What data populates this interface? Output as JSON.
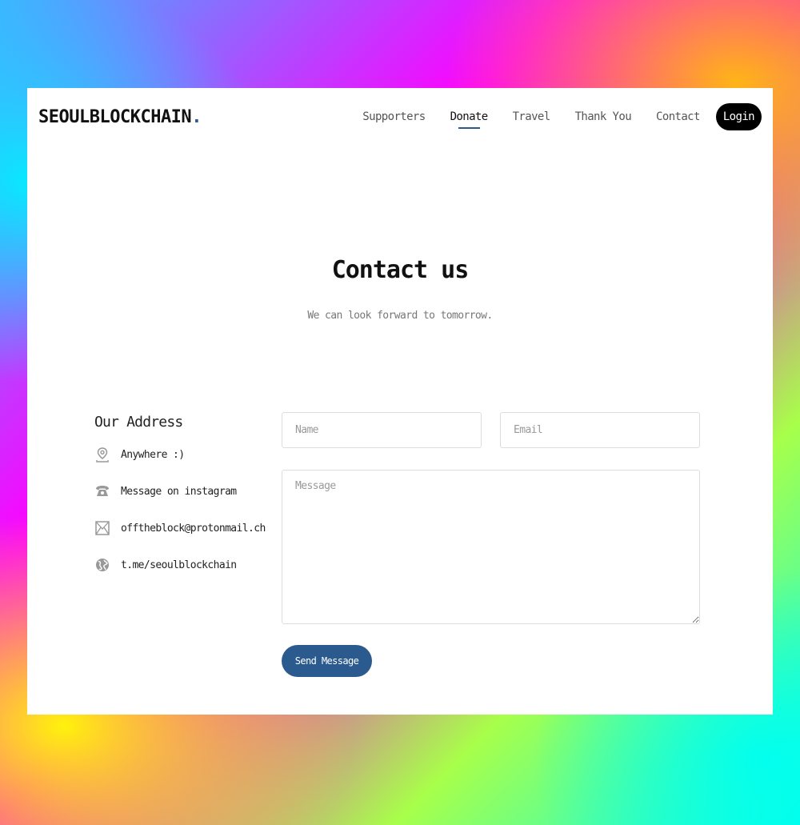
{
  "brand": {
    "name": "SEOULBLOCKCHAIN",
    "dot": "."
  },
  "nav": {
    "items": [
      {
        "label": "Supporters"
      },
      {
        "label": "Donate"
      },
      {
        "label": "Travel"
      },
      {
        "label": "Thank You"
      },
      {
        "label": "Contact"
      }
    ],
    "active": "Donate",
    "login_label": "Login"
  },
  "hero": {
    "title": "Contact us",
    "subtitle": "We can look forward to tomorrow."
  },
  "address": {
    "heading": "Our Address",
    "items": [
      {
        "icon": "map-pin-icon",
        "text": "Anywhere :)"
      },
      {
        "icon": "phone-icon",
        "text": "Message on instagram"
      },
      {
        "icon": "envelope-icon",
        "text": "offtheblock@protonmail.ch"
      },
      {
        "icon": "globe-icon",
        "text": "t.me/seoulblockchain"
      }
    ]
  },
  "form": {
    "name_placeholder": "Name",
    "email_placeholder": "Email",
    "message_placeholder": "Message",
    "send_label": "Send Message"
  },
  "colors": {
    "accent": "#2b5a8e",
    "login_bg": "#000000"
  }
}
